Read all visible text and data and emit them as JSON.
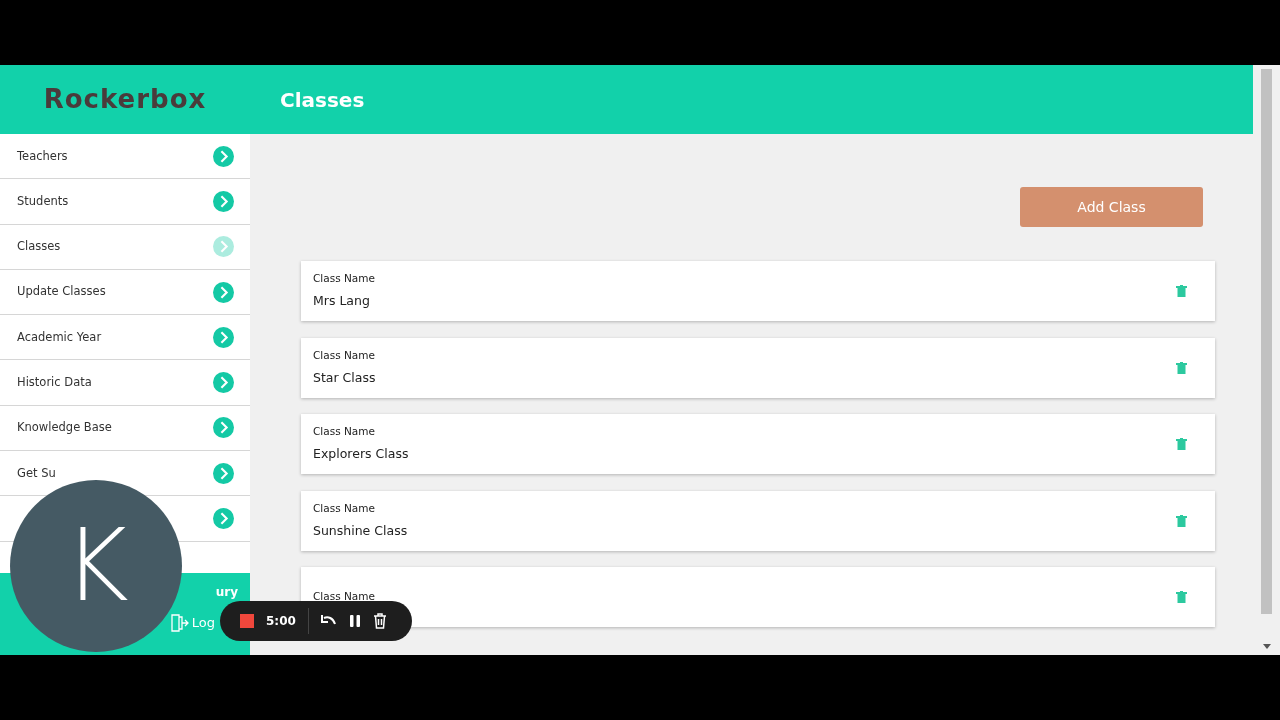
{
  "header": {
    "logo": "Rockerbox",
    "title": "Classes"
  },
  "sidebar": {
    "items": [
      {
        "label": "Teachers",
        "selected": false
      },
      {
        "label": "Students",
        "selected": false
      },
      {
        "label": "Classes",
        "selected": true
      },
      {
        "label": "Update Classes",
        "selected": false
      },
      {
        "label": "Academic Year",
        "selected": false
      },
      {
        "label": "Historic Data",
        "selected": false
      },
      {
        "label": "Knowledge Base",
        "selected": false
      },
      {
        "label": "Get Su",
        "selected": false
      },
      {
        "selected": false
      }
    ],
    "footer": {
      "name": "ury",
      "logout": "Log"
    }
  },
  "add_button": "Add Class",
  "classes": [
    {
      "label": "Class Name",
      "value": "Mrs Lang"
    },
    {
      "label": "Class Name",
      "value": "Star Class"
    },
    {
      "label": "Class Name",
      "value": "Explorers Class"
    },
    {
      "label": "Class Name",
      "value": "Sunshine Class"
    },
    {
      "label": "Class Name"
    }
  ],
  "webcam": {
    "initial": "K"
  },
  "recorder": {
    "time": "5:00"
  }
}
